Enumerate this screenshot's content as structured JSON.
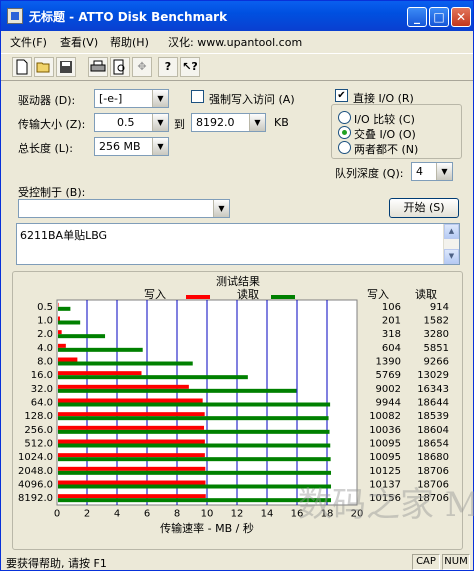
{
  "window": {
    "title": "无标题 - ATTO Disk Benchmark",
    "min": "_",
    "max": "□",
    "close": "✕"
  },
  "menu": [
    {
      "label": "文件(F)"
    },
    {
      "label": "查看(V)"
    },
    {
      "label": "帮助(H)"
    },
    {
      "label": "汉化: www.upantool.com"
    }
  ],
  "toolbar": [
    "new",
    "open",
    "save",
    "print",
    "print-preview",
    "move",
    "help",
    "context-help"
  ],
  "settings": {
    "drive_label": "驱动器 (D):",
    "drive_value": "[-e-]",
    "force_write_label": "强制写入访问 (A)",
    "force_write_checked": false,
    "transfer_label": "传输大小 (Z):",
    "transfer_from": "0.5",
    "to_label": "到",
    "transfer_to": "8192.0",
    "unit": "KB",
    "total_label": "总长度 (L):",
    "total_value": "256 MB",
    "direct_io_label": "直接 I/O (R)",
    "direct_io_checked": true,
    "radio_compare": "I/O 比较 (C)",
    "radio_overlap": "交叠 I/O (O)",
    "radio_neither": "两者都不 (N)",
    "radio_selected": "overlap",
    "queue_label": "队列深度 (Q):",
    "queue_value": "4",
    "controlled_label": "受控制于 (B):",
    "controlled_value": "",
    "start_label": "开始 (S)",
    "notes": "6211BA单贴LBG"
  },
  "results": {
    "title": "测试结果",
    "legend_write": "写入",
    "legend_read": "读取",
    "col_write": "写入",
    "col_read": "读取",
    "colors": {
      "write": "#FF0000",
      "read": "#008000",
      "grid": "#0000C0"
    }
  },
  "chart_data": {
    "type": "bar",
    "orientation": "horizontal",
    "xlabel": "传输速率 - MB / 秒",
    "xlim": [
      0,
      20
    ],
    "xticks": [
      0,
      2,
      4,
      6,
      8,
      10,
      12,
      14,
      16,
      18,
      20
    ],
    "categories": [
      "0.5",
      "1.0",
      "2.0",
      "4.0",
      "8.0",
      "16.0",
      "32.0",
      "64.0",
      "128.0",
      "256.0",
      "512.0",
      "1024.0",
      "2048.0",
      "4096.0",
      "8192.0"
    ],
    "series": [
      {
        "name": "写入",
        "values": [
          106,
          201,
          318,
          604,
          1390,
          5769,
          9002,
          9944,
          10082,
          10036,
          10095,
          10095,
          10125,
          10137,
          10156
        ]
      },
      {
        "name": "读取",
        "values": [
          914,
          1582,
          3280,
          5851,
          9266,
          13029,
          16343,
          18644,
          18539,
          18604,
          18654,
          18680,
          18706,
          18706,
          18706
        ]
      }
    ]
  },
  "watermark": "数码之家 MyDigit.net",
  "status": {
    "text": "要获得帮助, 请按 F1",
    "cap": "CAP",
    "num": "NUM"
  }
}
